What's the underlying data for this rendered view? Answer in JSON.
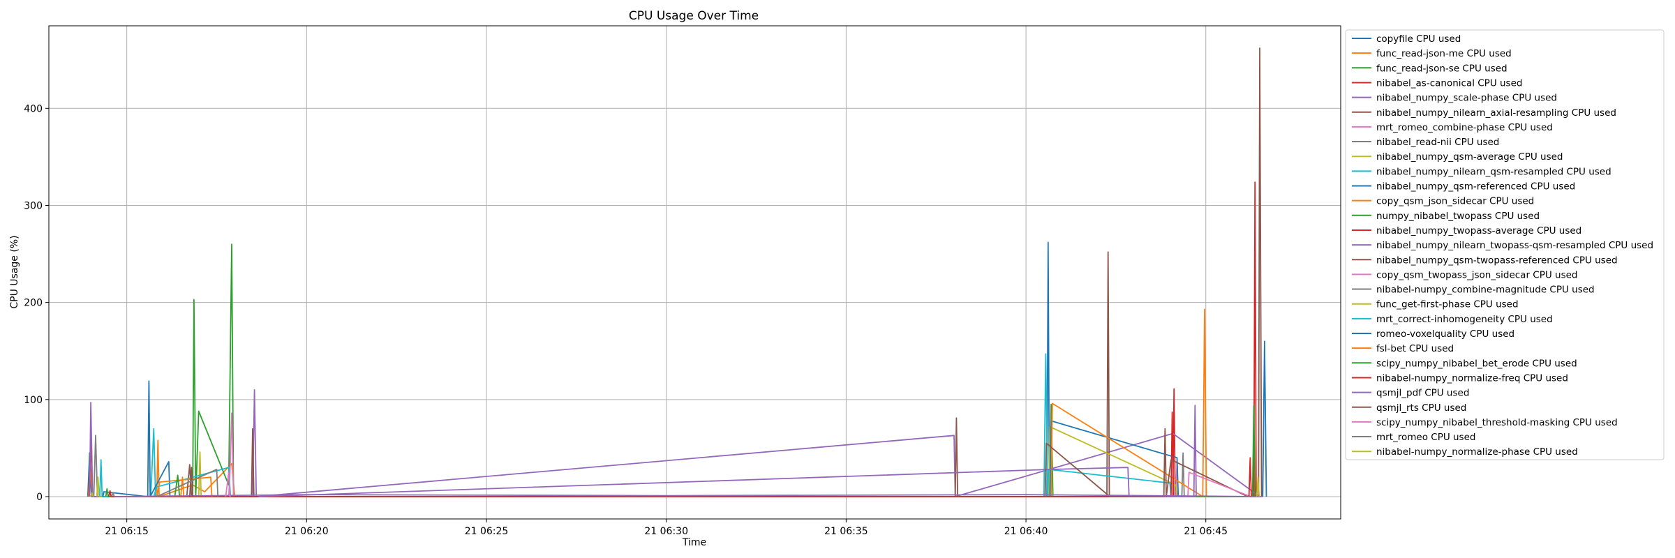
{
  "chart_data": {
    "type": "line",
    "title": "CPU Usage Over Time",
    "xlabel": "Time",
    "ylabel": "CPU Usage (%)",
    "x_ticks": [
      "21 06:15",
      "21 06:20",
      "21 06:25",
      "21 06:30",
      "21 06:35",
      "21 06:40",
      "21 06:45"
    ],
    "y_ticks": [
      0,
      100,
      200,
      300,
      400
    ],
    "xlim": [
      "06:12:50",
      "06:48:45"
    ],
    "ylim": [
      -23,
      485
    ],
    "grid": true,
    "legend_position": "outside-right",
    "colors": [
      "#1f77b4",
      "#ff7f0e",
      "#2ca02c",
      "#d62728",
      "#9467bd",
      "#8c564b",
      "#e377c2",
      "#7f7f7f",
      "#bcbd22",
      "#17becf"
    ],
    "series": [
      {
        "name": "copyfile CPU used",
        "points": [
          [
            "06:13:55",
            0
          ],
          [
            "06:13:58",
            45
          ],
          [
            "06:14:01",
            0
          ],
          [
            "06:40:35",
            0
          ],
          [
            "06:40:37",
            262
          ],
          [
            "06:40:39",
            0
          ],
          [
            "06:46:30",
            0
          ]
        ]
      },
      {
        "name": "func_read-json-me CPU used",
        "points": [
          [
            "06:13:56",
            0
          ],
          [
            "06:13:59",
            28
          ],
          [
            "06:14:03",
            0
          ],
          [
            "06:15:50",
            0
          ],
          [
            "06:15:52",
            58
          ],
          [
            "06:15:54",
            0
          ],
          [
            "06:16:50",
            12
          ],
          [
            "06:17:10",
            5
          ],
          [
            "06:17:55",
            34
          ],
          [
            "06:18:00",
            0
          ]
        ]
      },
      {
        "name": "func_read-json-se CPU used",
        "points": [
          [
            "06:16:50",
            0
          ],
          [
            "06:16:52",
            203
          ],
          [
            "06:16:55",
            0
          ],
          [
            "06:17:00",
            88
          ],
          [
            "06:17:50",
            12
          ],
          [
            "06:17:55",
            260
          ],
          [
            "06:17:58",
            0
          ],
          [
            "06:40:40",
            0
          ],
          [
            "06:40:42",
            95
          ],
          [
            "06:40:45",
            0
          ]
        ]
      },
      {
        "name": "nibabel_as-canonical CPU used",
        "points": [
          [
            "06:13:57",
            0
          ],
          [
            "06:14:00",
            55
          ],
          [
            "06:14:03",
            0
          ],
          [
            "06:44:05",
            0
          ],
          [
            "06:44:07",
            111
          ],
          [
            "06:44:09",
            0
          ],
          [
            "06:46:20",
            0
          ],
          [
            "06:46:22",
            324
          ],
          [
            "06:46:24",
            0
          ],
          [
            "06:46:28",
            0
          ]
        ]
      },
      {
        "name": "nibabel_numpy_scale-phase CPU used",
        "points": [
          [
            "06:13:58",
            0
          ],
          [
            "06:14:00",
            97
          ],
          [
            "06:14:03",
            0
          ],
          [
            "06:18:30",
            0
          ],
          [
            "06:18:33",
            110
          ],
          [
            "06:18:36",
            0
          ],
          [
            "06:38:00",
            63
          ],
          [
            "06:38:02",
            0
          ],
          [
            "06:44:05",
            65
          ],
          [
            "06:46:30",
            0
          ]
        ]
      },
      {
        "name": "nibabel_numpy_nilearn_axial-resampling CPU used",
        "points": [
          [
            "06:16:40",
            0
          ],
          [
            "06:16:45",
            33
          ],
          [
            "06:16:48",
            0
          ],
          [
            "06:18:28",
            0
          ],
          [
            "06:18:30",
            70
          ],
          [
            "06:18:32",
            0
          ],
          [
            "06:38:02",
            0
          ],
          [
            "06:38:04",
            81
          ],
          [
            "06:38:06",
            0
          ],
          [
            "06:42:15",
            0
          ],
          [
            "06:42:17",
            252
          ],
          [
            "06:42:19",
            0
          ],
          [
            "06:46:28",
            0
          ],
          [
            "06:46:30",
            462
          ],
          [
            "06:46:33",
            0
          ]
        ]
      },
      {
        "name": "mrt_romeo_combine-phase CPU used",
        "points": [
          [
            "06:17:50",
            0
          ],
          [
            "06:17:52",
            22
          ],
          [
            "06:17:55",
            86
          ],
          [
            "06:17:58",
            0
          ],
          [
            "06:44:10",
            0
          ],
          [
            "06:44:12",
            38
          ],
          [
            "06:44:14",
            0
          ]
        ]
      },
      {
        "name": "nibabel_read-nii CPU used",
        "points": [
          [
            "06:14:05",
            0
          ],
          [
            "06:14:08",
            63
          ],
          [
            "06:14:11",
            0
          ],
          [
            "06:44:20",
            0
          ],
          [
            "06:44:22",
            45
          ],
          [
            "06:44:24",
            0
          ]
        ]
      },
      {
        "name": "nibabel_numpy_qsm-average CPU used",
        "points": [
          [
            "06:14:10",
            0
          ],
          [
            "06:14:12",
            20
          ],
          [
            "06:14:14",
            0
          ],
          [
            "06:17:00",
            0
          ],
          [
            "06:17:02",
            46
          ],
          [
            "06:17:04",
            0
          ],
          [
            "06:40:38",
            0
          ],
          [
            "06:40:40",
            72
          ],
          [
            "06:44:10",
            12
          ],
          [
            "06:44:12",
            0
          ]
        ]
      },
      {
        "name": "nibabel_numpy_nilearn_qsm-resampled CPU used",
        "points": [
          [
            "06:14:15",
            0
          ],
          [
            "06:14:17",
            38
          ],
          [
            "06:14:19",
            0
          ],
          [
            "06:15:40",
            0
          ],
          [
            "06:15:45",
            70
          ],
          [
            "06:15:48",
            0
          ],
          [
            "06:40:30",
            0
          ],
          [
            "06:40:33",
            147
          ],
          [
            "06:40:36",
            0
          ],
          [
            "06:40:38",
            28
          ],
          [
            "06:44:00",
            14
          ],
          [
            "06:44:02",
            0
          ]
        ]
      },
      {
        "name": "nibabel_numpy_qsm-referenced CPU used",
        "points": [
          [
            "06:14:20",
            0
          ],
          [
            "06:14:22",
            5
          ],
          [
            "06:15:35",
            0
          ],
          [
            "06:15:37",
            119
          ],
          [
            "06:15:39",
            0
          ],
          [
            "06:16:10",
            36
          ],
          [
            "06:16:12",
            0
          ],
          [
            "06:40:40",
            0
          ],
          [
            "06:40:42",
            78
          ],
          [
            "06:44:12",
            40
          ],
          [
            "06:44:14",
            0
          ]
        ]
      },
      {
        "name": "copy_qsm_json_sidecar CPU used",
        "points": [
          [
            "06:16:30",
            0
          ],
          [
            "06:16:33",
            20
          ],
          [
            "06:16:35",
            0
          ],
          [
            "06:40:42",
            0
          ],
          [
            "06:40:44",
            96
          ],
          [
            "06:44:55",
            0
          ],
          [
            "06:44:58",
            193
          ],
          [
            "06:45:01",
            0
          ]
        ]
      },
      {
        "name": "numpy_nibabel_twopass CPU used",
        "points": [
          [
            "06:14:25",
            0
          ],
          [
            "06:14:27",
            8
          ],
          [
            "06:14:29",
            0
          ],
          [
            "06:46:18",
            0
          ],
          [
            "06:46:20",
            94
          ],
          [
            "06:46:22",
            0
          ]
        ]
      },
      {
        "name": "nibabel_numpy_twopass-average CPU used",
        "points": [
          [
            "06:14:30",
            0
          ],
          [
            "06:14:32",
            6
          ],
          [
            "06:14:34",
            0
          ],
          [
            "06:44:02",
            0
          ],
          [
            "06:44:04",
            87
          ],
          [
            "06:44:06",
            0
          ]
        ]
      },
      {
        "name": "nibabel_numpy_nilearn_twopass-qsm-resampled CPU used",
        "points": [
          [
            "06:18:40",
            0
          ],
          [
            "06:40:40",
            28
          ],
          [
            "06:42:50",
            30
          ],
          [
            "06:42:52",
            0
          ],
          [
            "06:44:40",
            0
          ],
          [
            "06:44:42",
            94
          ],
          [
            "06:44:44",
            0
          ]
        ]
      },
      {
        "name": "nibabel_numpy_qsm-twopass-referenced CPU used",
        "points": [
          [
            "06:40:32",
            0
          ],
          [
            "06:40:34",
            55
          ],
          [
            "06:42:20",
            0
          ],
          [
            "06:43:50",
            0
          ],
          [
            "06:43:52",
            70
          ],
          [
            "06:43:54",
            0
          ],
          [
            "06:44:02",
            38
          ],
          [
            "06:46:10",
            0
          ]
        ]
      },
      {
        "name": "copy_qsm_twopass_json_sidecar CPU used",
        "points": [
          [
            "06:44:30",
            0
          ],
          [
            "06:44:32",
            25
          ],
          [
            "06:46:15",
            0
          ]
        ]
      },
      {
        "name": "nibabel-numpy_combine-magnitude CPU used",
        "points": [
          [
            "06:14:35",
            0
          ],
          [
            "06:14:37",
            4
          ],
          [
            "06:14:39",
            0
          ]
        ]
      },
      {
        "name": "func_get-first-phase CPU used",
        "points": [
          [
            "06:14:00",
            0
          ],
          [
            "06:14:02",
            4
          ],
          [
            "06:14:04",
            0
          ]
        ]
      },
      {
        "name": "mrt_correct-inhomogeneity CPU used",
        "points": [
          [
            "06:15:45",
            0
          ],
          [
            "06:15:50",
            10
          ],
          [
            "06:17:50",
            30
          ],
          [
            "06:17:53",
            0
          ]
        ]
      },
      {
        "name": "romeo-voxelquality CPU used",
        "points": [
          [
            "06:46:35",
            0
          ],
          [
            "06:46:38",
            160
          ],
          [
            "06:46:41",
            0
          ]
        ]
      },
      {
        "name": "fsl-bet CPU used",
        "points": [
          [
            "06:15:50",
            0
          ],
          [
            "06:15:55",
            15
          ],
          [
            "06:17:20",
            20
          ],
          [
            "06:17:22",
            0
          ]
        ]
      },
      {
        "name": "scipy_numpy_nibabel_bet_erode CPU used",
        "points": [
          [
            "06:16:20",
            0
          ],
          [
            "06:16:25",
            22
          ],
          [
            "06:16:28",
            0
          ]
        ]
      },
      {
        "name": "nibabel-numpy_normalize-freq CPU used",
        "points": [
          [
            "06:46:12",
            0
          ],
          [
            "06:46:14",
            40
          ],
          [
            "06:46:16",
            0
          ]
        ]
      },
      {
        "name": "qsmjl_pdf CPU used",
        "points": [
          [
            "06:14:40",
            0
          ],
          [
            "06:20:00",
            2
          ],
          [
            "06:30:00",
            1
          ],
          [
            "06:40:00",
            2
          ],
          [
            "06:46:35",
            0
          ]
        ]
      },
      {
        "name": "qsmjl_rts CPU used",
        "points": [
          [
            "06:16:45",
            0
          ],
          [
            "06:16:48",
            30
          ],
          [
            "06:16:50",
            0
          ]
        ]
      },
      {
        "name": "scipy_numpy_nibabel_threshold-masking CPU used",
        "points": [
          [
            "06:17:45",
            0
          ],
          [
            "06:17:50",
            25
          ],
          [
            "06:17:52",
            0
          ]
        ]
      },
      {
        "name": "mrt_romeo CPU used",
        "points": [
          [
            "06:15:50",
            0
          ],
          [
            "06:17:30",
            28
          ],
          [
            "06:17:32",
            0
          ]
        ]
      },
      {
        "name": "nibabel-numpy_normalize-phase CPU used",
        "points": [
          [
            "06:46:25",
            0
          ],
          [
            "06:46:27",
            20
          ],
          [
            "06:46:29",
            0
          ]
        ]
      }
    ]
  }
}
